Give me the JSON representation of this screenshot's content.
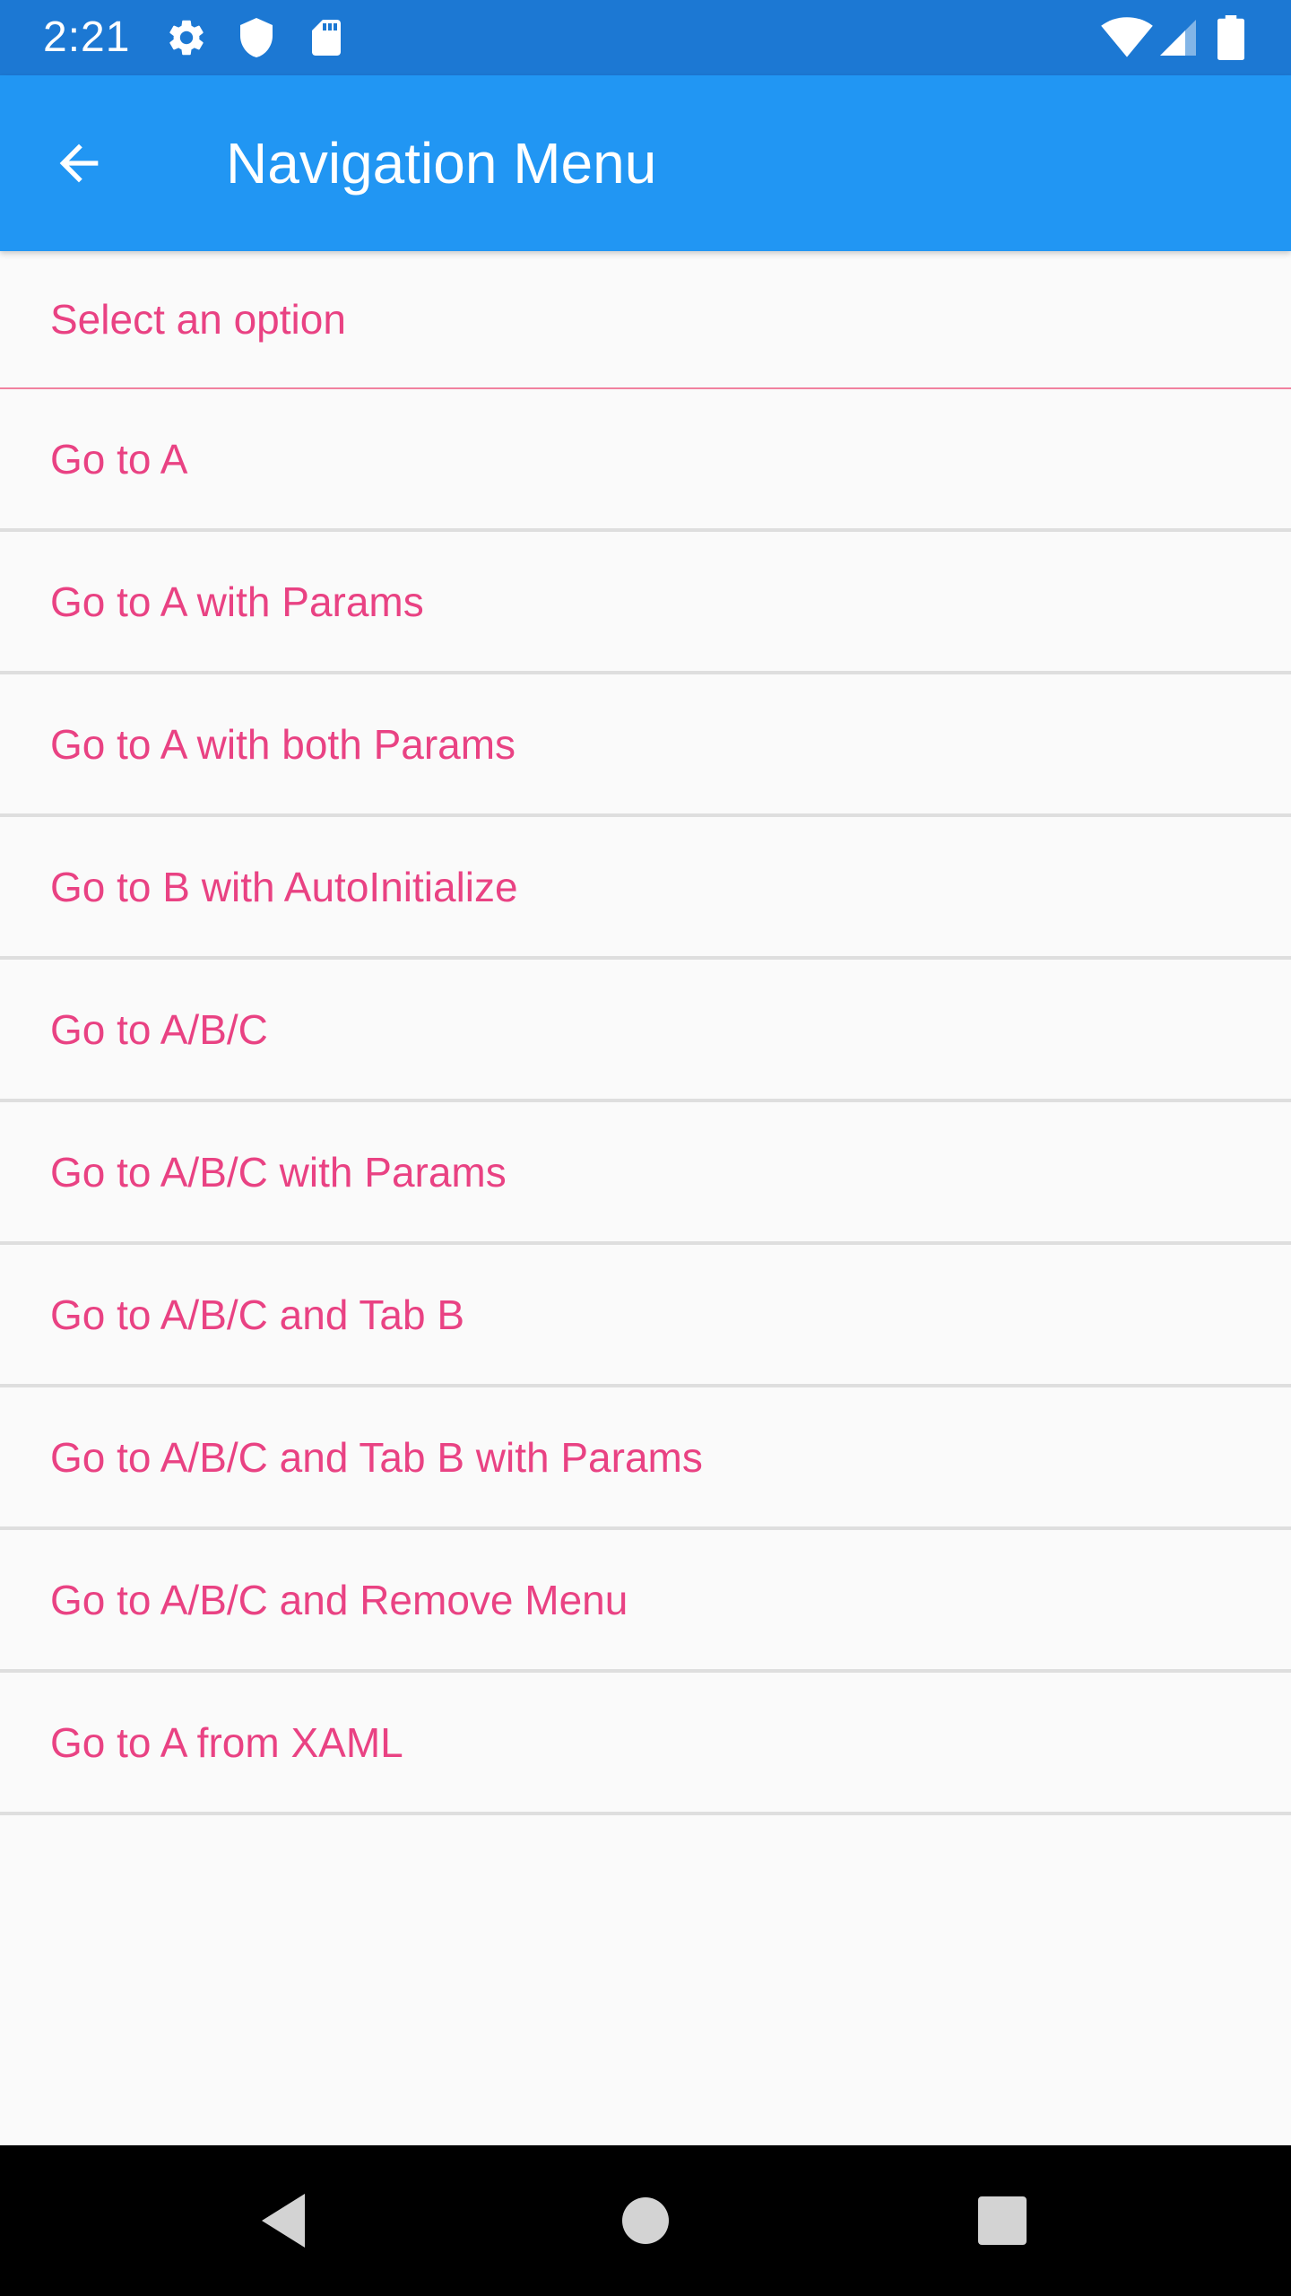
{
  "status_bar": {
    "time": "2:21",
    "left_icons": [
      "gear-icon",
      "shield-icon",
      "sd-card-icon"
    ],
    "right_icons": [
      "wifi-icon",
      "cell-signal-icon",
      "battery-icon"
    ]
  },
  "app_bar": {
    "title": "Navigation Menu",
    "back_icon": "arrow-left-icon",
    "background_color": "#2196f3"
  },
  "menu": {
    "header": "Select an option",
    "items": [
      {
        "label": "Go to A"
      },
      {
        "label": "Go to A with Params"
      },
      {
        "label": "Go to A with both Params"
      },
      {
        "label": "Go to B with AutoInitialize"
      },
      {
        "label": "Go to A/B/C"
      },
      {
        "label": "Go to A/B/C with Params"
      },
      {
        "label": "Go to A/B/C and Tab B"
      },
      {
        "label": "Go to A/B/C and Tab B with Params"
      },
      {
        "label": "Go to A/B/C and Remove Menu"
      },
      {
        "label": "Go to A from XAML"
      }
    ],
    "text_color": "#e94283"
  },
  "nav_bar": {
    "buttons": [
      "back-triangle-icon",
      "home-circle-icon",
      "recents-square-icon"
    ]
  }
}
